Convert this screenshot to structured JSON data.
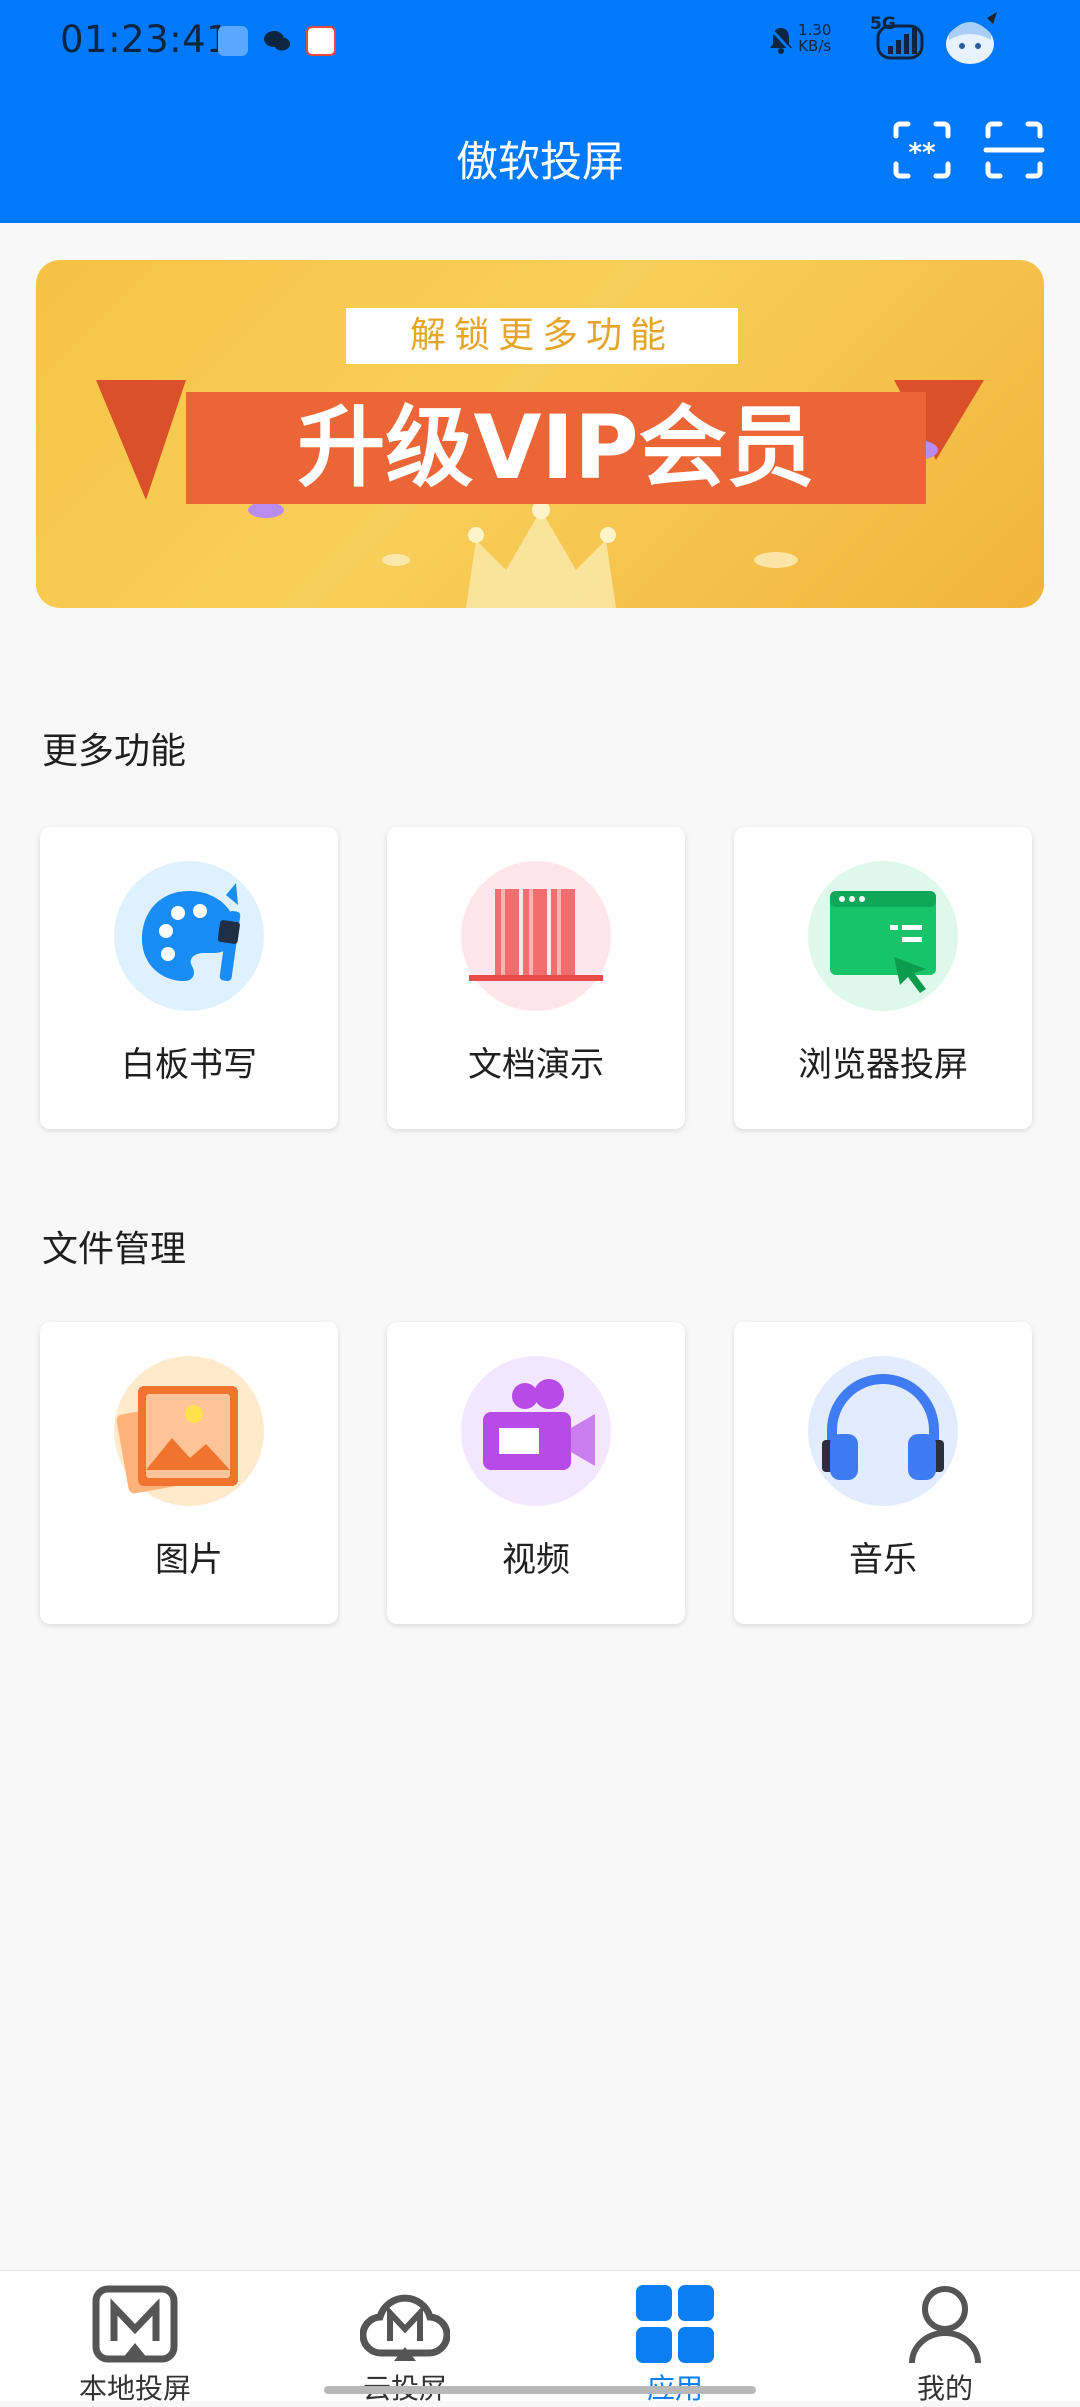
{
  "status_bar": {
    "time": "01:23:41",
    "speed_value": "1.30",
    "speed_unit": "KB/s",
    "network": "5G"
  },
  "header": {
    "title": "傲软投屏"
  },
  "banner": {
    "tag": "解锁更多功能",
    "headline": "升级VIP会员"
  },
  "sections": [
    {
      "title": "更多功能",
      "items": [
        {
          "label": "白板书写",
          "icon": "palette-icon"
        },
        {
          "label": "文档演示",
          "icon": "document-icon"
        },
        {
          "label": "浏览器投屏",
          "icon": "browser-icon"
        }
      ]
    },
    {
      "title": "文件管理",
      "items": [
        {
          "label": "图片",
          "icon": "picture-icon"
        },
        {
          "label": "视频",
          "icon": "video-camera-icon"
        },
        {
          "label": "音乐",
          "icon": "headphones-icon"
        }
      ]
    }
  ],
  "bottom_nav": [
    {
      "label": "本地投屏",
      "active": false
    },
    {
      "label": "云投屏",
      "active": false
    },
    {
      "label": "应用",
      "active": true
    },
    {
      "label": "我的",
      "active": false
    }
  ],
  "colors": {
    "primary": "#0179fb",
    "active_tab": "#0a7ef2",
    "banner_ribbon": "#ec6536"
  }
}
